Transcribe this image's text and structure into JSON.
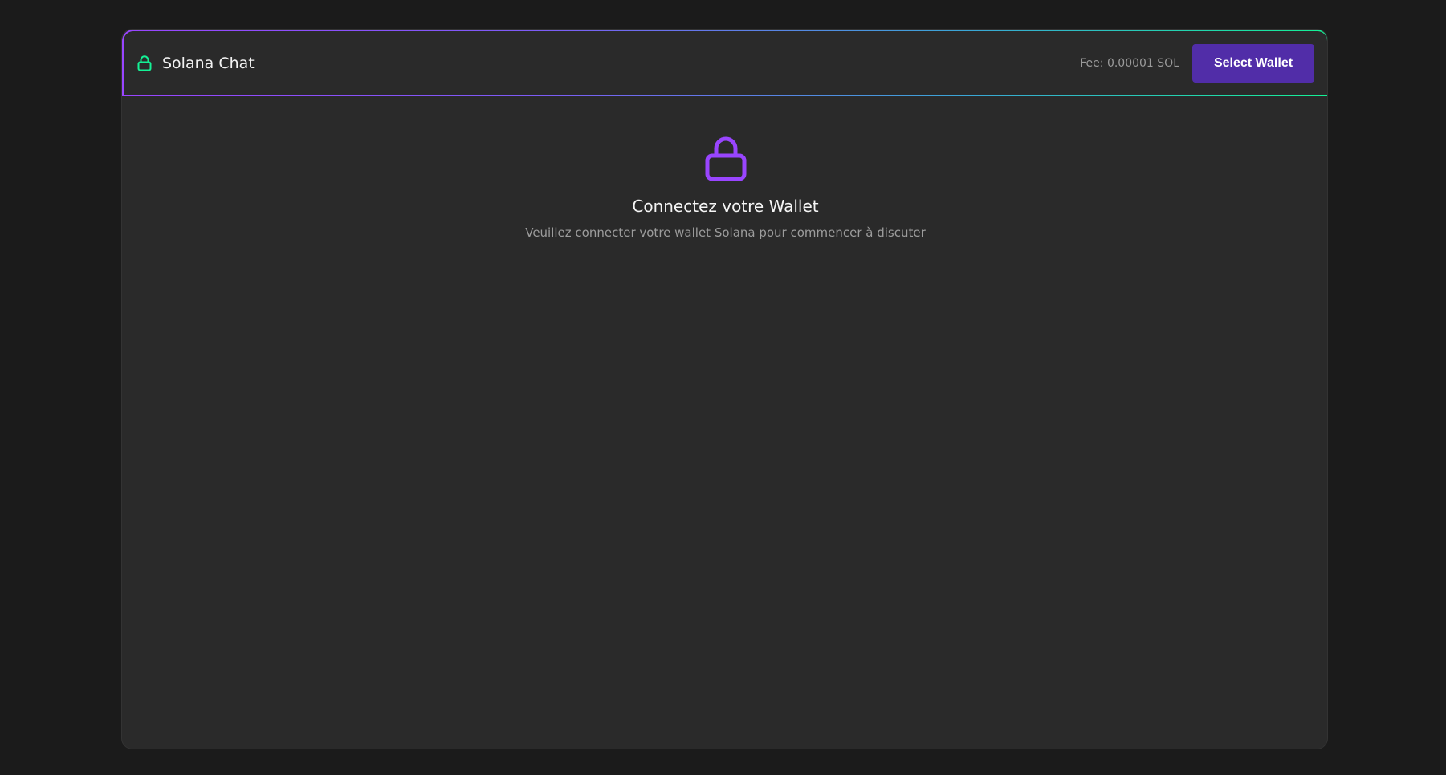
{
  "header": {
    "title": "Solana Chat",
    "brand_icon": "lock-icon",
    "fee_text": "Fee: 0.00001 SOL",
    "select_wallet_label": "Select Wallet"
  },
  "connect": {
    "icon": "lock-icon",
    "title": "Connectez votre Wallet",
    "subtitle": "Veuillez connecter votre wallet Solana pour commencer à discuter"
  },
  "colors": {
    "background": "#1b1b1b",
    "card": "#2a2a2a",
    "accent_purple": "#9945ff",
    "accent_green": "#14f195",
    "button": "#512da8"
  }
}
